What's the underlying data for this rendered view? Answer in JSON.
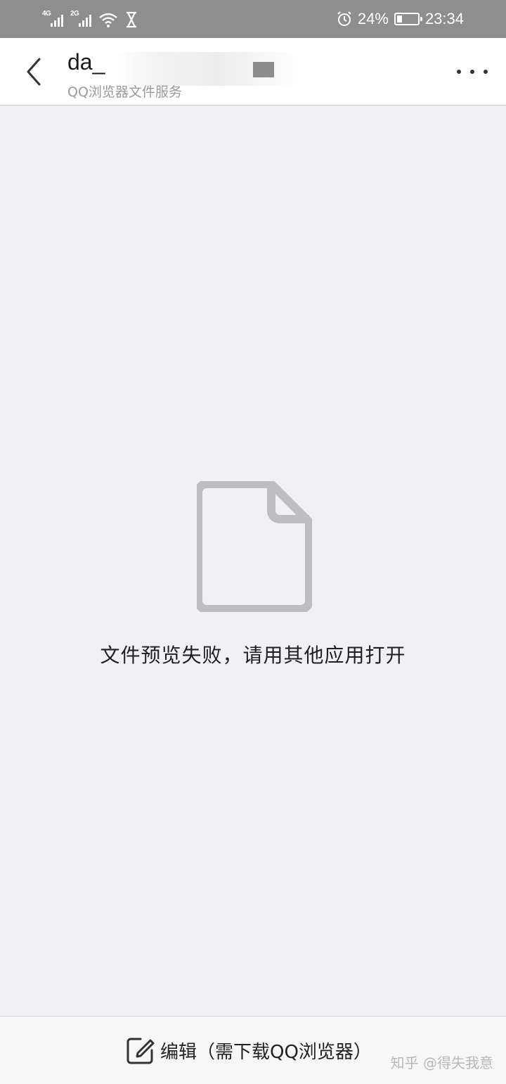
{
  "status_bar": {
    "network_1": "4G",
    "network_2": "2G",
    "battery_percent": "24%",
    "battery_level": 0.24,
    "time": "23:34",
    "icons": [
      "signal-icon",
      "wifi-icon",
      "hourglass-icon",
      "alarm-icon",
      "battery-icon"
    ]
  },
  "header": {
    "title": "da_",
    "subtitle": "QQ浏览器文件服务",
    "icons": [
      "back-arrow-icon",
      "more-dots-icon"
    ]
  },
  "main": {
    "icon": "document-icon",
    "message": "文件预览失败，请用其他应用打开"
  },
  "bottom_bar": {
    "edit_label": "编辑（需下载QQ浏览器）",
    "edit_icon": "edit-icon",
    "watermark": "知乎 @得失我意"
  },
  "colors": {
    "status_bar_bg": "#8e8e8e",
    "content_bg": "#f1f0f5",
    "icon_gray": "#bebec1"
  }
}
